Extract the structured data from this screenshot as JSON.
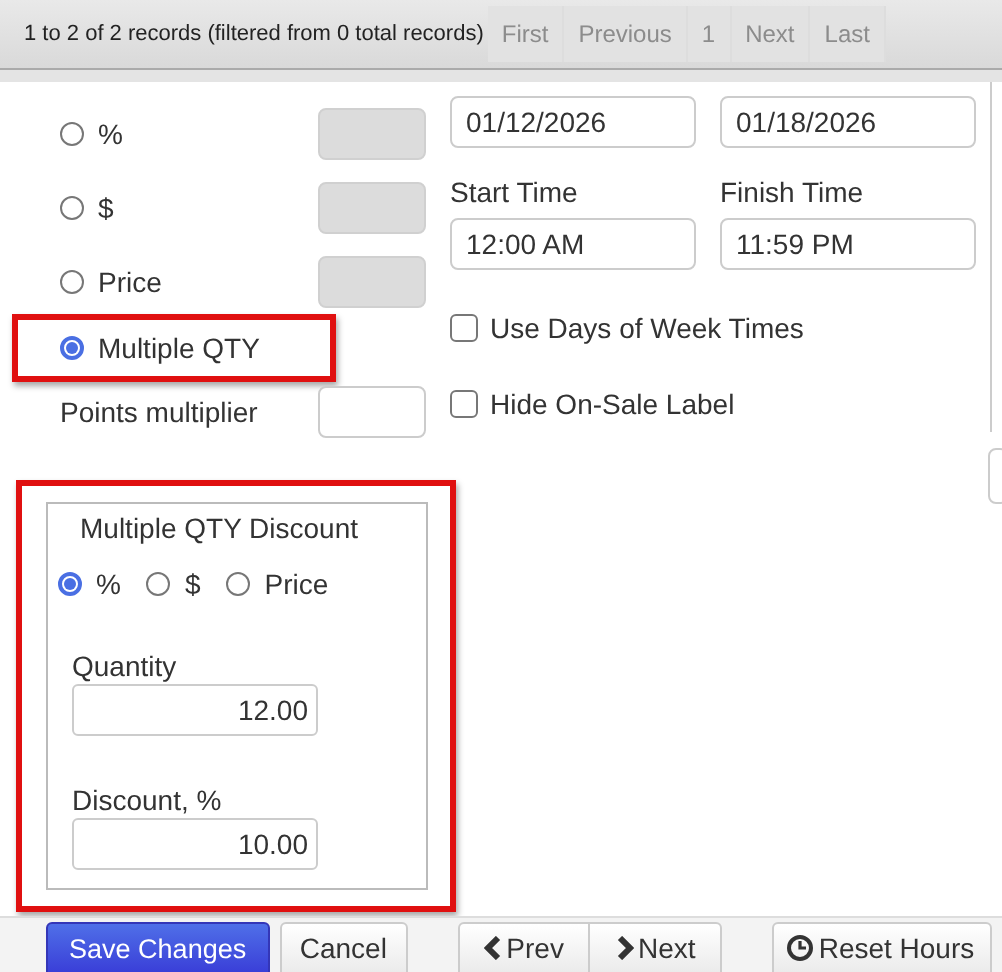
{
  "pager": {
    "summary": "1 to 2 of 2 records (filtered from 0 total records)",
    "buttons": [
      {
        "label": "First",
        "disabled": true
      },
      {
        "label": "Previous",
        "disabled": true
      },
      {
        "label": "1",
        "disabled": true
      },
      {
        "label": "Next",
        "disabled": true
      },
      {
        "label": "Last",
        "disabled": true
      }
    ]
  },
  "discount_types": [
    {
      "label": "%",
      "selected": false,
      "highlighted": false,
      "has_amount": true
    },
    {
      "label": "$",
      "selected": false,
      "highlighted": false,
      "has_amount": true
    },
    {
      "label": "Price",
      "selected": false,
      "highlighted": false,
      "has_amount": true
    },
    {
      "label": "Multiple QTY",
      "selected": true,
      "highlighted": true,
      "has_amount": false
    }
  ],
  "points_multiplier": {
    "label": "Points multiplier"
  },
  "start": {
    "date": "01/12/2026",
    "time_label": "Start Time",
    "time": "12:00 AM"
  },
  "finish": {
    "date": "01/18/2026",
    "time_label": "Finish Time",
    "time": "11:59 PM"
  },
  "checkboxes": [
    {
      "label": "Use Days of Week Times",
      "checked": false
    },
    {
      "label": "Hide On-Sale Label",
      "checked": false
    }
  ],
  "multi_qty": {
    "title": "Multiple QTY Discount",
    "highlighted": true,
    "options": [
      {
        "label": "%",
        "selected": true
      },
      {
        "label": "$",
        "selected": false
      },
      {
        "label": "Price",
        "selected": false
      }
    ],
    "fields": [
      {
        "label": "Quantity",
        "value": "12.00"
      },
      {
        "label": "Discount, %",
        "value": "10.00"
      }
    ]
  },
  "footer_buttons": [
    {
      "label": "Save Changes",
      "kind": "primary"
    },
    {
      "label": "Cancel",
      "kind": "plain"
    },
    {
      "label": "Prev",
      "kind": "prev"
    },
    {
      "label": "Next",
      "kind": "next"
    },
    {
      "label": "Reset Hours",
      "kind": "reset"
    }
  ]
}
